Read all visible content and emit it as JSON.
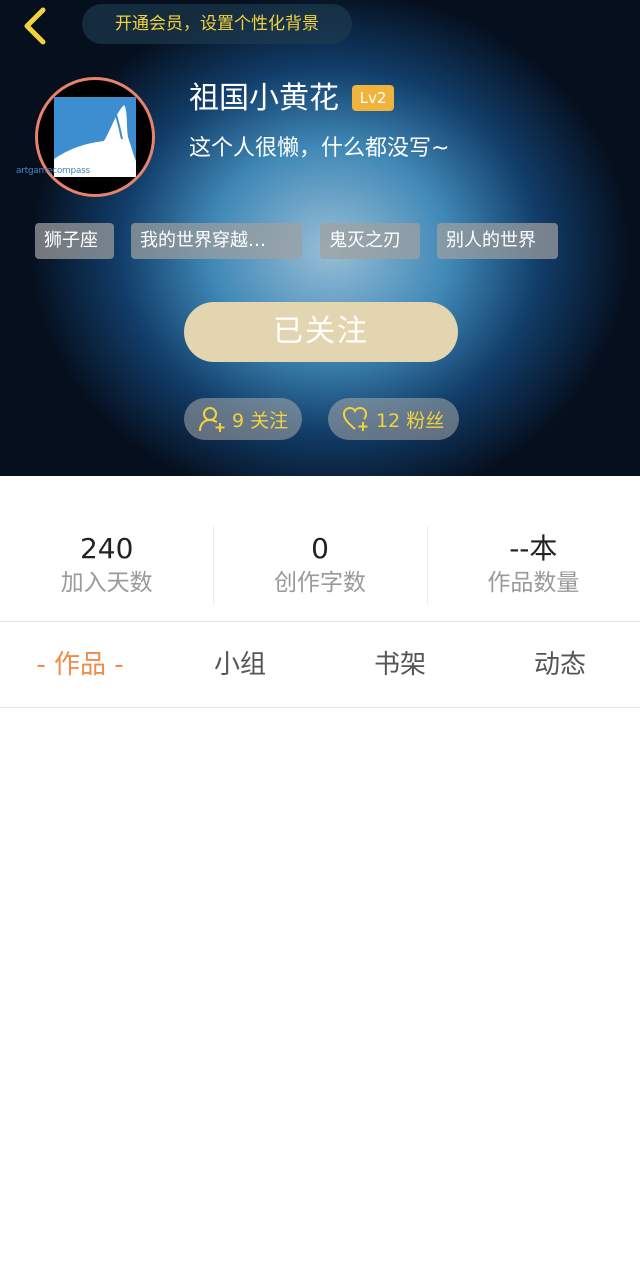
{
  "header": {
    "vip_banner": "开通会员，设置个性化背景",
    "avatar_caption": "artgamecompass",
    "username": "祖国小黄花",
    "level": "Lv2",
    "bio": "这个人很懒，什么都没写~",
    "tags": [
      "狮子座",
      "我的世界穿越…",
      "鬼灭之刃",
      "别人的世界"
    ],
    "follow_button": "已关注",
    "following": "9 关注",
    "fans": "12 粉丝"
  },
  "stats": [
    {
      "value": "240",
      "label": "加入天数"
    },
    {
      "value": "0",
      "label": "创作字数"
    },
    {
      "value": "--本",
      "label": "作品数量"
    }
  ],
  "tabs": [
    {
      "label": "- 作品 -",
      "active": true
    },
    {
      "label": "小组",
      "active": false
    },
    {
      "label": "书架",
      "active": false
    },
    {
      "label": "动态",
      "active": false
    }
  ],
  "colors": {
    "accent": "#f08b4a",
    "vip_text": "#f3d23c",
    "level_badge": "#f0b33c",
    "follow_button": "#e3d5b0",
    "avatar_border": "#e8826a"
  }
}
